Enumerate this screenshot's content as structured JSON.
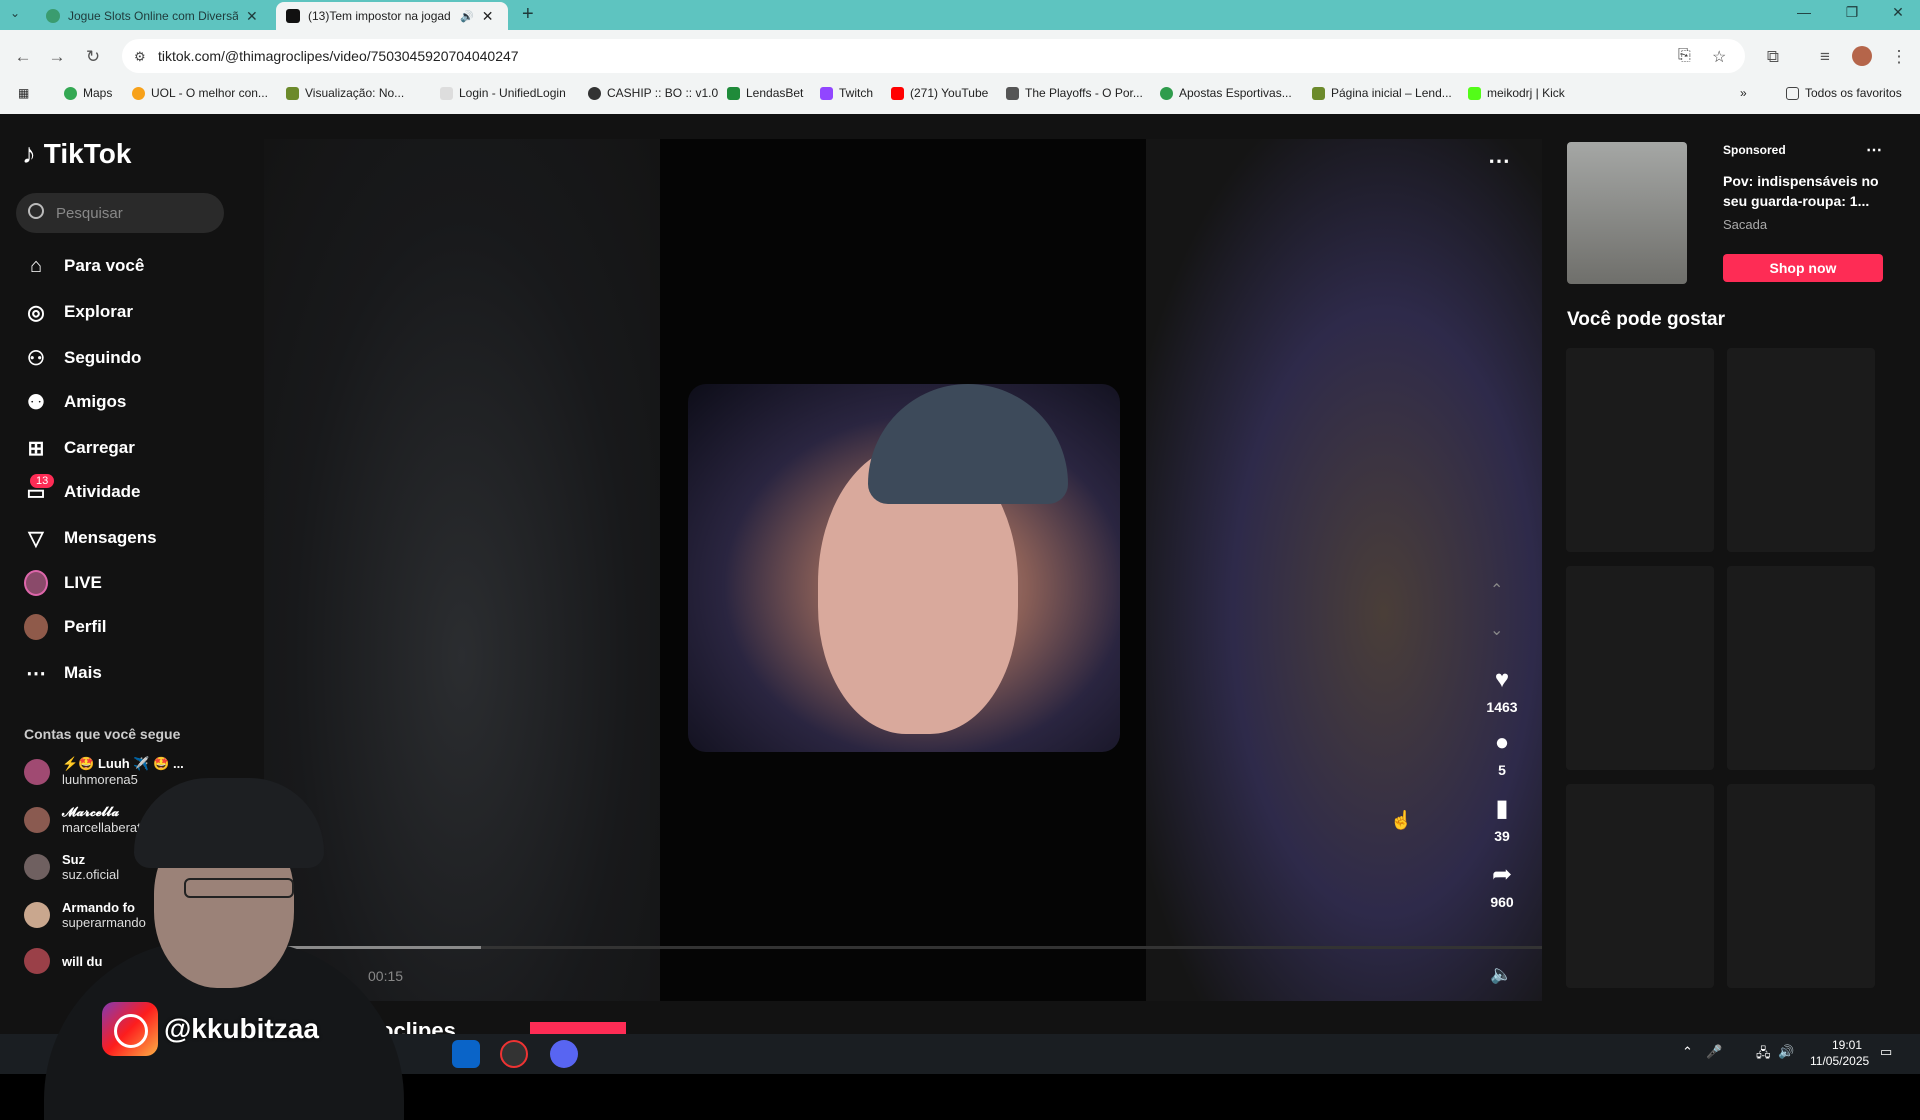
{
  "browser": {
    "tabs": [
      {
        "label": "Jogue Slots Online com Diversã",
        "active": false
      },
      {
        "label": "(13)Tem impostor na jogad",
        "active": true
      }
    ],
    "url": "tiktok.com/@thimagroclipes/video/7503045920704040247",
    "bookmarks": [
      "Maps",
      "UOL - O melhor con...",
      "Visualização: No...",
      "Login - UnifiedLogin",
      "CASHIP :: BO :: v1.0",
      "LendasBet",
      "Twitch",
      "(271) YouTube",
      "The Playoffs - O Por...",
      "Apostas Esportivas...",
      "Página inicial – Lend...",
      "meikodrj | Kick"
    ],
    "bookmarks_folder": "Todos os favoritos"
  },
  "tiktok": {
    "logo": "TikTok",
    "search_placeholder": "Pesquisar",
    "nav": [
      {
        "label": "Para você",
        "icon": "home-icon"
      },
      {
        "label": "Explorar",
        "icon": "compass-icon"
      },
      {
        "label": "Seguindo",
        "icon": "following-icon"
      },
      {
        "label": "Amigos",
        "icon": "friends-icon"
      },
      {
        "label": "Carregar",
        "icon": "upload-icon"
      },
      {
        "label": "Atividade",
        "icon": "inbox-icon"
      },
      {
        "label": "Mensagens",
        "icon": "send-icon"
      },
      {
        "label": "LIVE",
        "icon": "live-icon"
      },
      {
        "label": "Perfil",
        "icon": "avatar-icon"
      },
      {
        "label": "Mais",
        "icon": "more-icon"
      }
    ],
    "activity_badge": "13",
    "following_header": "Contas que você segue",
    "accounts": [
      {
        "name": "⚡🤩 Luuh ✈️ 🤩 ...",
        "handle": "luuhmorena5"
      },
      {
        "name": "𝓜𝓪𝓻𝓬𝓮𝓵𝓵𝓪",
        "handle": "marcellaberat"
      },
      {
        "name": "Suz",
        "handle": "suz.oficial"
      },
      {
        "name": "Armando fo",
        "handle": "superarmando"
      },
      {
        "name": "will du",
        "handle": ""
      }
    ],
    "video": {
      "likes": "1463",
      "comments": "5",
      "saves": "39",
      "shares": "960",
      "time": "00:15",
      "progress_fraction": 0.17,
      "author": "oclipes"
    },
    "ad": {
      "sponsored": "Sponsored",
      "title": "Pov: indispensáveis no seu guarda-roupa: 1...",
      "brand": "Sacada",
      "cta": "Shop now"
    },
    "recommended_header": "Você pode gostar"
  },
  "overlay": {
    "instagram_handle": "@kkubitzaa"
  },
  "taskbar": {
    "time": "19:01",
    "date": "11/05/2025"
  },
  "colors": {
    "accent": "#fe2c55",
    "tabstrip": "#5ec4c0",
    "page_bg": "#121212"
  }
}
